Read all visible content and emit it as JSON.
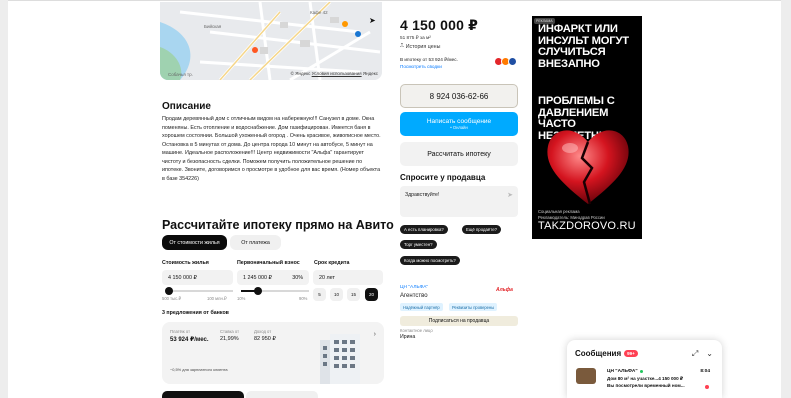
{
  "map": {
    "attribution_prefix": "© Яндекс",
    "attribution_link": "Условия использования",
    "attribution_brand": "Яндекс",
    "labels": [
      "Бийская",
      "Собачья тр.",
      "Старый ЦУМ",
      "Кафе 42",
      "Магнит"
    ]
  },
  "description": {
    "title": "Описание",
    "text": "Продам деревянный дом с отличным видом на набережную!!! Санузел в доме. Окна поменяны. Есть отопление и водоснабжение. Дом газифицирован. Имеется баня в хорошем состоянии. Большой ухоженный огород . Очень красивое, живописное место. Остановка в 5 минутах от дома. До центра города 10 минут на автобусе, 5 минут на машине. Идеальное расположение!!! Центр недвижимости \"Альфа\" гарантирует чистоту и безопасность сделки. Поможем получить положительное решение по ипотеке. Звоните, договоримся о просмотре в удобное для вас время. (Номер объекта в базе 354226)"
  },
  "mortgage": {
    "title": "Рассчитайте ипотеку прямо на Авито",
    "tabs": [
      "От стоимости жилья",
      "От платежа"
    ],
    "fields": {
      "price_label": "Стоимость жилья",
      "price_value": "4 150 000 ₽",
      "down_label": "Первоначальный взнос",
      "down_value": "1 245 000 ₽",
      "down_pct": "30%",
      "term_label": "Срок кредита",
      "term_value": "20 лет"
    },
    "slider_price": {
      "min": "500 тыс.₽",
      "max": "100 млн.₽",
      "fraction": 0.04
    },
    "slider_down": {
      "min": "10%",
      "max": "90%",
      "fraction": 0.25
    },
    "terms": [
      "5",
      "10",
      "15",
      "20"
    ],
    "active_term": "20",
    "offers_title": "3 предложения от банков",
    "offer": {
      "payment_label": "Платёж от",
      "payment_value": "53 924 ₽/мес.",
      "rate_label": "Ставка от",
      "rate_value": "21,99%",
      "income_label": "Доход от",
      "income_value": "82 950 ₽",
      "note": "−0,5% для зарплатного клиента",
      "arrow": "›"
    }
  },
  "listing": {
    "price": "4 150 000 ₽",
    "price_per_m2": "51 875 ₽ за м²",
    "price_history": "История цены",
    "mortgage_line": "В ипотеку от 53 924 ₽/мес.",
    "mortgage_link": "Посмотреть сводки",
    "phone": "8 924 036-62-66",
    "message_btn": "Написать сообщение",
    "message_sub": "• Онлайн",
    "calc_btn": "Рассчитать ипотеку",
    "bank_colors": [
      "#e3262a",
      "#ff7a00",
      "#1f4fa3"
    ]
  },
  "ask": {
    "title": "Спросите у продавца",
    "placeholder": "Здравствуйте!",
    "chips": [
      "А есть планировка?",
      "Ещё продаёте?",
      "Торг уместен?",
      "Когда можно посмотреть?"
    ]
  },
  "seller": {
    "name": "ЦН \"АЛЬФА\"",
    "type": "Агентство",
    "logo": "Альфа",
    "tags": [
      "Надёжный партнёр",
      "Реквизиты проверены"
    ],
    "subscribe": "Подписаться на продавца",
    "contact_label": "Контактное лицо",
    "contact_name": "Ирина"
  },
  "ad": {
    "badge": "РЕКЛАМА",
    "headline": "ИНФАРКТ ИЛИ ИНСУЛЬТ МОГУТ СЛУЧИТЬСЯ ВНЕЗАПНО",
    "headline2": "ПРОБЛЕМЫ С ДАВЛЕНИЕМ ЧАСТО НЕЗАМЕТНЫ",
    "small1": "Социальная реклама",
    "small2": "Рекламодатель: Минздрав России",
    "site": "TAKZDOROVO.RU"
  },
  "messages": {
    "title": "Сообщения",
    "badge": "99+",
    "sender": "ЦН \"АЛЬФА\"",
    "time": "8:04",
    "line1": "Дом 80 м² на участке...4 150 000 ₽",
    "line2": "Вы посмотрели временный ном..."
  }
}
